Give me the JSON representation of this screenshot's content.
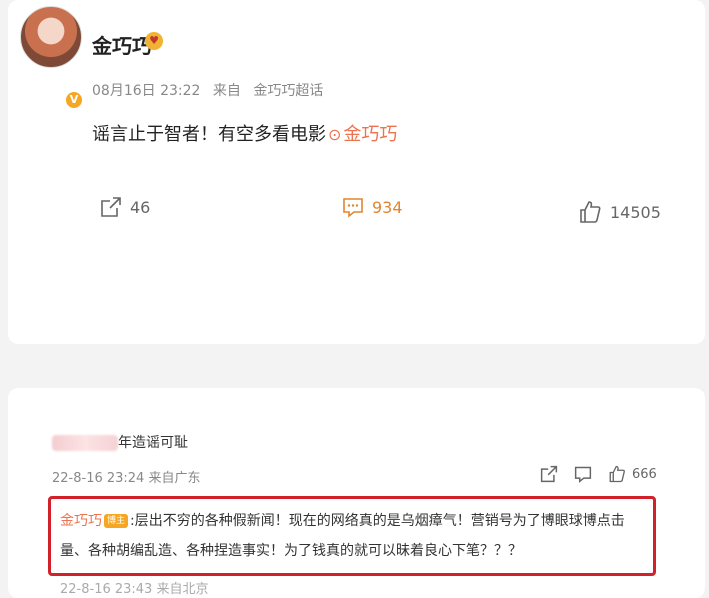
{
  "post": {
    "username": "金巧巧",
    "timestamp": "08月16日 23:22",
    "source_prefix": "来自",
    "source": "金巧巧超话",
    "content_text": "谣言止于智者！有空多看电影",
    "content_link": "金巧巧",
    "actions": {
      "share_count": "46",
      "comment_count": "934",
      "like_count": "14505"
    },
    "colors": {
      "accent": "#eb7350",
      "comment": "#e2852e"
    },
    "icons": [
      "share-icon",
      "comment-icon",
      "like-icon",
      "location-icon",
      "verified-icon",
      "crown-icon"
    ]
  },
  "comment": {
    "user_visible_text": "年造谣可耻",
    "timestamp": "22-8-16 23:24",
    "source": "来自广东",
    "like_count": "666",
    "reply": {
      "name": "金巧巧",
      "badge": "博主",
      "text": ":层出不穷的各种假新闻！现在的网络真的是乌烟瘴气！营销号为了博眼球博点击量、各种胡编乱造、各种捏造事实！为了钱真的就可以昧着良心下笔？？？"
    },
    "next_meta": "22-8-16 23:43 来自北京",
    "highlight_color": "#d2212b"
  }
}
